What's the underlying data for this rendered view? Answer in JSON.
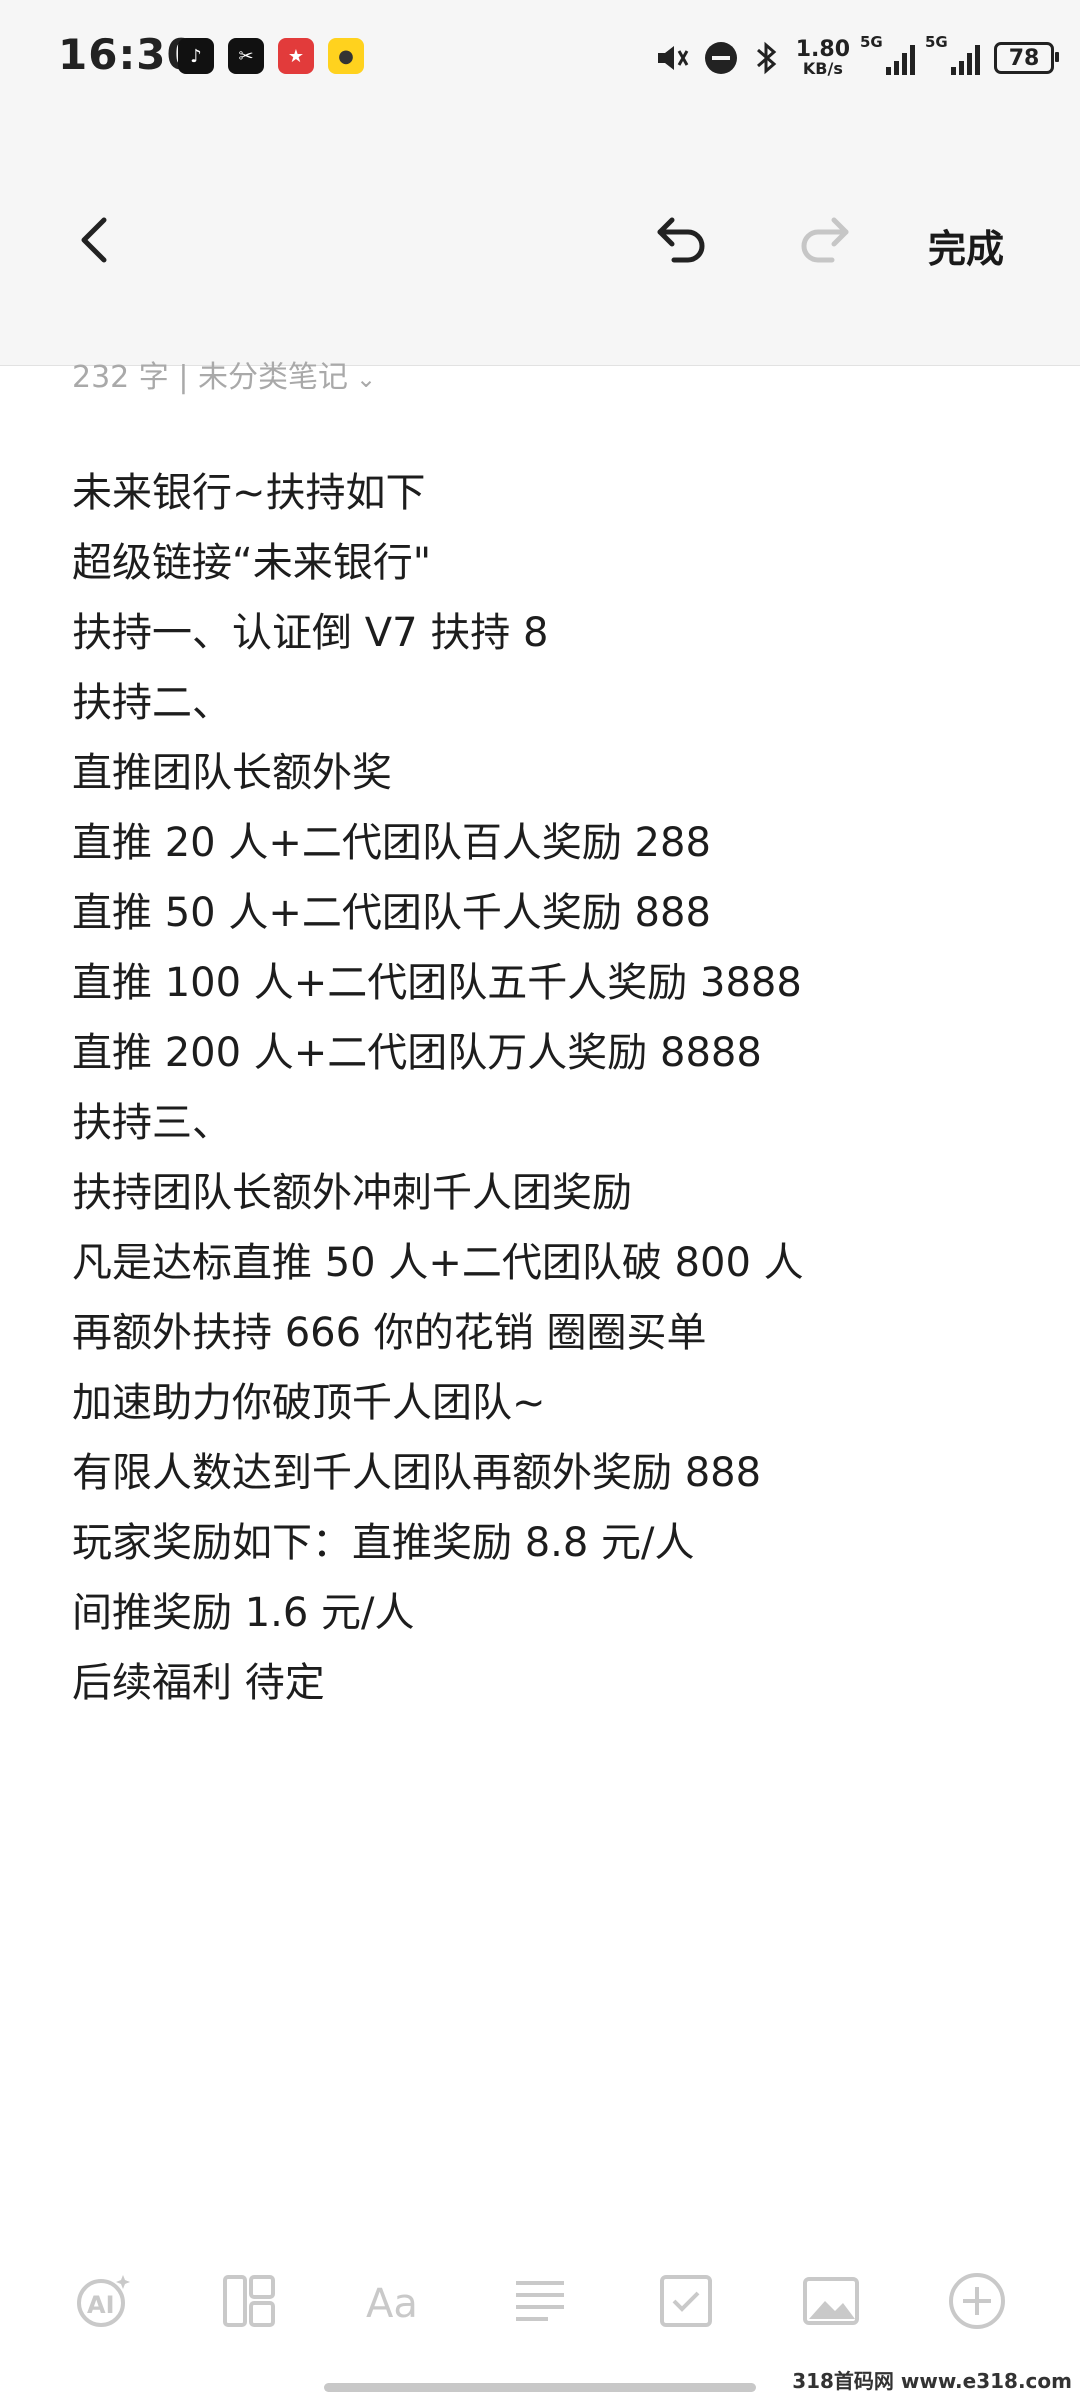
{
  "status_bar": {
    "time": "16:30",
    "apps": [
      "tiktok-icon",
      "capcut-icon",
      "red-app-icon",
      "yellow-app-icon"
    ],
    "net_speed_value": "1.80",
    "net_speed_unit": "KB/s",
    "sim1": "5G",
    "sim2": "5G",
    "battery": "78"
  },
  "toolbar_top": {
    "done_label": "完成"
  },
  "note_meta": {
    "text": "232 字 | 未分类笔记"
  },
  "note_lines": [
    "未来银行~扶持如下",
    "超级链接“未来银行\"",
    "扶持一、认证倒 V7 扶持 8",
    "扶持二、",
    "直推团队长额外奖",
    "直推 20 人+二代团队百人奖励 288",
    "直推 50 人+二代团队千人奖励 888",
    "直推 100 人+二代团队五千人奖励 3888",
    "直推 200 人+二代团队万人奖励 8888",
    "扶持三、",
    "扶持团队长额外冲刺千人团奖励",
    "凡是达标直推 50 人+二代团队破 800 人",
    "再额外扶持 666 你的花销 圈圈买单",
    "加速助力你破顶千人团队~",
    "有限人数达到千人团队再额外奖励 888",
    "玩家奖励如下：直推奖励 8.8 元/人",
    "间推奖励 1.6 元/人",
    "后续福利 待定"
  ],
  "watermark": "318首码网 www.e318.com"
}
